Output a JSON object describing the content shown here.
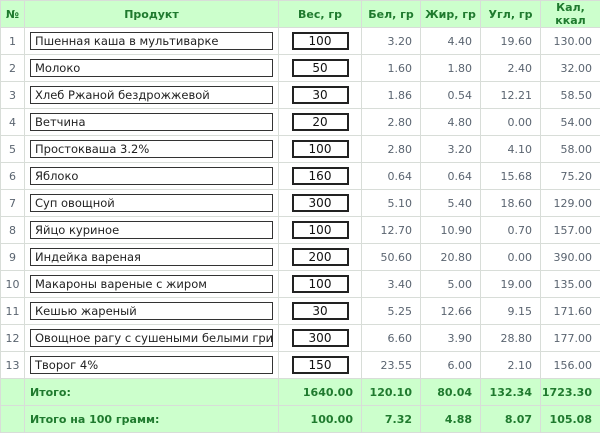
{
  "headers": {
    "num": "№",
    "product": "Продукт",
    "weight": "Вес, гр",
    "protein": "Бел, гр",
    "fat": "Жир, гр",
    "carbs": "Угл, гр",
    "kcal": "Кал, ккал"
  },
  "rows": [
    {
      "n": "1",
      "name": "Пшенная каша в мультиварке",
      "weight": "100",
      "protein": "3.20",
      "fat": "4.40",
      "carbs": "19.60",
      "kcal": "130.00"
    },
    {
      "n": "2",
      "name": "Молоко",
      "weight": "50",
      "protein": "1.60",
      "fat": "1.80",
      "carbs": "2.40",
      "kcal": "32.00"
    },
    {
      "n": "3",
      "name": "Хлеб Ржаной бездрожжевой",
      "weight": "30",
      "protein": "1.86",
      "fat": "0.54",
      "carbs": "12.21",
      "kcal": "58.50"
    },
    {
      "n": "4",
      "name": "Ветчина",
      "weight": "20",
      "protein": "2.80",
      "fat": "4.80",
      "carbs": "0.00",
      "kcal": "54.00"
    },
    {
      "n": "5",
      "name": "Простокваша 3.2%",
      "weight": "100",
      "protein": "2.80",
      "fat": "3.20",
      "carbs": "4.10",
      "kcal": "58.00"
    },
    {
      "n": "6",
      "name": "Яблоко",
      "weight": "160",
      "protein": "0.64",
      "fat": "0.64",
      "carbs": "15.68",
      "kcal": "75.20"
    },
    {
      "n": "7",
      "name": "Суп овощной",
      "weight": "300",
      "protein": "5.10",
      "fat": "5.40",
      "carbs": "18.60",
      "kcal": "129.00"
    },
    {
      "n": "8",
      "name": "Яйцо куриное",
      "weight": "100",
      "protein": "12.70",
      "fat": "10.90",
      "carbs": "0.70",
      "kcal": "157.00"
    },
    {
      "n": "9",
      "name": "Индейка вареная",
      "weight": "200",
      "protein": "50.60",
      "fat": "20.80",
      "carbs": "0.00",
      "kcal": "390.00"
    },
    {
      "n": "10",
      "name": "Макароны вареные с жиром",
      "weight": "100",
      "protein": "3.40",
      "fat": "5.00",
      "carbs": "19.00",
      "kcal": "135.00"
    },
    {
      "n": "11",
      "name": "Кешью жареный",
      "weight": "30",
      "protein": "5.25",
      "fat": "12.66",
      "carbs": "9.15",
      "kcal": "171.60"
    },
    {
      "n": "12",
      "name": "Овощное рагу с сушеными белыми грибами",
      "weight": "300",
      "protein": "6.60",
      "fat": "3.90",
      "carbs": "28.80",
      "kcal": "177.00"
    },
    {
      "n": "13",
      "name": "Творог 4%",
      "weight": "150",
      "protein": "23.55",
      "fat": "6.00",
      "carbs": "2.10",
      "kcal": "156.00"
    }
  ],
  "totals": {
    "label": "Итого:",
    "weight": "1640.00",
    "protein": "120.10",
    "fat": "80.04",
    "carbs": "132.34",
    "kcal": "1723.30"
  },
  "per100": {
    "label": "Итого на 100 грамм:",
    "weight": "100.00",
    "protein": "7.32",
    "fat": "4.88",
    "carbs": "8.07",
    "kcal": "105.08"
  }
}
